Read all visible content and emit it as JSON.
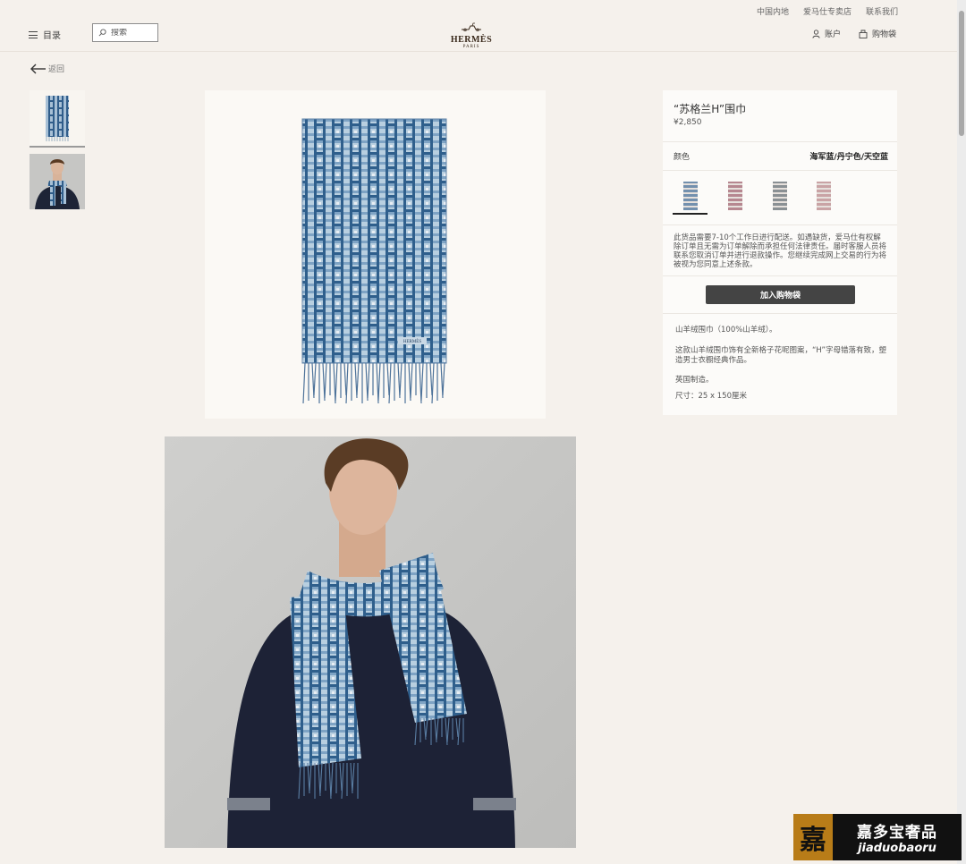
{
  "header": {
    "util_links": [
      "中国内地",
      "爱马仕专卖店",
      "联系我们"
    ],
    "menu_label": "目录",
    "search_placeholder": "搜索",
    "logo_text": "HERMÈS",
    "logo_sub": "PARIS",
    "account_label": "账户",
    "bag_label": "购物袋"
  },
  "nav": {
    "back_label": "返回"
  },
  "product": {
    "title": "“苏格兰H”围巾",
    "price": "¥2,850",
    "color_label": "颜色",
    "color_value": "海军蓝/丹宁色/天空蓝",
    "swatches": [
      {
        "name": "navy-blue",
        "color": "#7390ae"
      },
      {
        "name": "red",
        "color": "#b68790"
      },
      {
        "name": "grey",
        "color": "#8a9094"
      },
      {
        "name": "pink",
        "color": "#c9a3a5"
      }
    ],
    "notice": "此货品需要7-10个工作日进行配送。如遇缺货，爱马仕有权解除订单且无需为订单解除而承担任何法律责任。届时客服人员将联系您取消订单并进行退款操作。您继续完成网上交易的行为将被视为您同意上述条款。",
    "add_to_bag": "加入购物袋",
    "description": [
      "山羊绒围巾（100%山羊绒）。",
      "这款山羊绒围巾饰有全新格子花呢图案，“H”字母错落有致，塑造男士衣橱经典作品。",
      "英国制造。",
      "尺寸：25 x 150厘米"
    ]
  },
  "scarf_label": "HERMÈS",
  "watermark": {
    "seal": "嘉",
    "text_cn": "嘉多宝奢品",
    "text_en": "jiaduobaoru"
  },
  "colors": {
    "background": "#f5f1ec",
    "scarf_dark": "#2e5f8e",
    "scarf_light": "#a9c4da",
    "button": "#444444"
  }
}
